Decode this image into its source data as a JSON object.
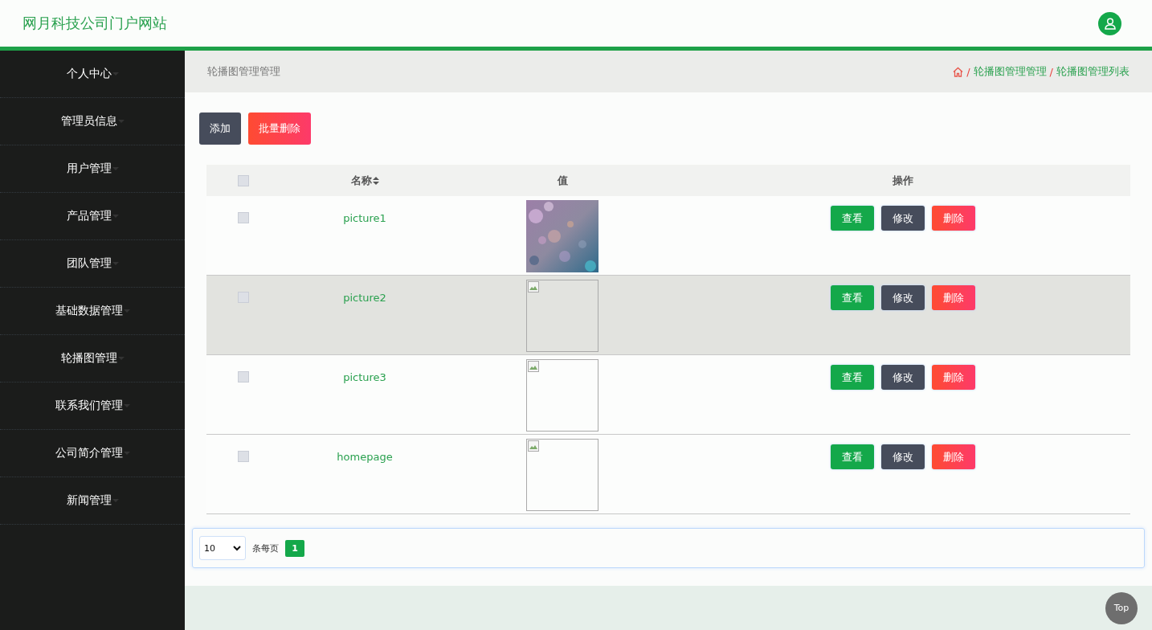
{
  "header": {
    "title": "网月科技公司门户网站"
  },
  "sidebar": {
    "items": [
      {
        "label": "个人中心"
      },
      {
        "label": "管理员信息"
      },
      {
        "label": "用户管理"
      },
      {
        "label": "产品管理"
      },
      {
        "label": "团队管理"
      },
      {
        "label": "基础数据管理"
      },
      {
        "label": "轮播图管理"
      },
      {
        "label": "联系我们管理"
      },
      {
        "label": "公司简介管理"
      },
      {
        "label": "新闻管理"
      }
    ]
  },
  "page_title": "轮播图管理管理",
  "breadcrumb": [
    {
      "kind": "separator",
      "text": "/"
    },
    {
      "kind": "link",
      "text": "轮播图管理管理"
    },
    {
      "kind": "separator",
      "text": "/"
    },
    {
      "kind": "link",
      "text": "轮播图管理列表"
    }
  ],
  "toolbar": {
    "buttons": [
      {
        "label": "添加",
        "kind": "dark"
      },
      {
        "label": "批量删除",
        "kind": "danger"
      }
    ]
  },
  "table": {
    "all_checked": false,
    "columns": [
      "名称",
      "值",
      "操作"
    ],
    "rows": [
      {
        "name": "picture1",
        "value": {
          "kind": "picture"
        },
        "highlighted": false,
        "checked": false,
        "actions": [
          "查看",
          "修改",
          "删除"
        ]
      },
      {
        "name": "picture2",
        "value": {
          "kind": "broken"
        },
        "highlighted": true,
        "checked": false,
        "actions": [
          "查看",
          "修改",
          "删除"
        ]
      },
      {
        "name": "picture3",
        "value": {
          "kind": "broken"
        },
        "highlighted": false,
        "checked": false,
        "actions": [
          "查看",
          "修改",
          "删除"
        ]
      },
      {
        "name": "homepage",
        "value": {
          "kind": "broken"
        },
        "highlighted": false,
        "checked": false,
        "actions": [
          "查看",
          "修改",
          "删除"
        ]
      }
    ]
  },
  "pagination": {
    "page_size": "10",
    "per_page_label": "条每页",
    "pages": [
      {
        "label": "1",
        "selected": true
      }
    ]
  },
  "top_button": "Top"
}
